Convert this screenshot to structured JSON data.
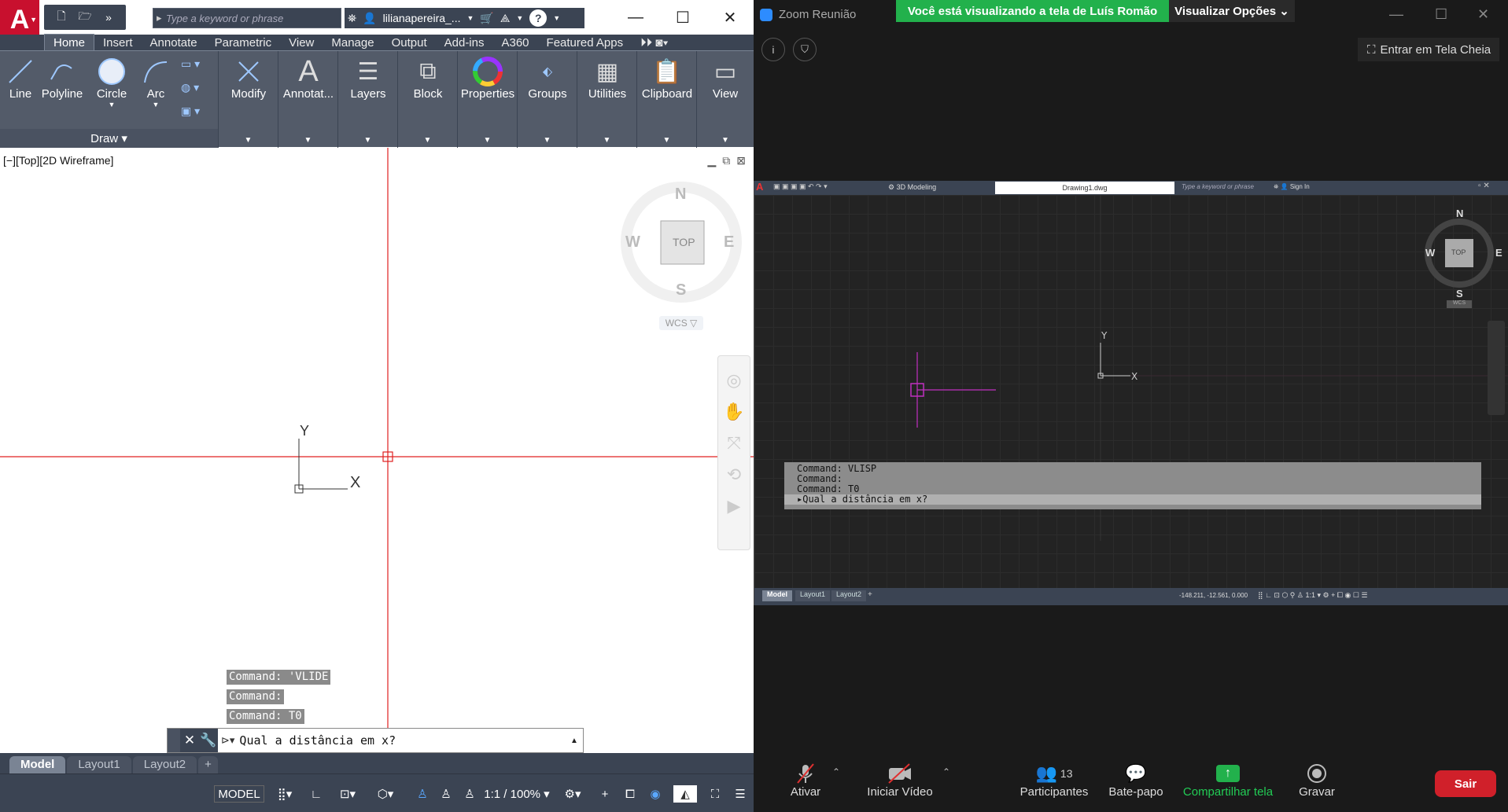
{
  "autocad": {
    "logo_letter": "A",
    "search_placeholder": "Type a keyword or phrase",
    "user_name": "lilianapereira_...",
    "help_label": "?",
    "ribbon_tabs": [
      "Home",
      "Insert",
      "Annotate",
      "Parametric",
      "View",
      "Manage",
      "Output",
      "Add-ins",
      "A360",
      "Featured Apps"
    ],
    "draw_tools": [
      "Line",
      "Polyline",
      "Circle",
      "Arc"
    ],
    "draw_panel_label": "Draw",
    "panels": [
      "Modify",
      "Annotat...",
      "Layers",
      "Block",
      "Properties",
      "Groups",
      "Utilities",
      "Clipboard",
      "View"
    ],
    "viewport_label": "[−][Top][2D Wireframe]",
    "viewcube": {
      "north": "N",
      "south": "S",
      "east": "E",
      "west": "W",
      "face": "TOP",
      "wcs": "WCS"
    },
    "ucs": {
      "x": "X",
      "y": "Y"
    },
    "command_history": [
      "Command: 'VLIDE",
      "Command:",
      "Command: T0"
    ],
    "command_prompt": "Qual a distância em x?",
    "layout_tabs": [
      "Model",
      "Layout1",
      "Layout2"
    ],
    "status": {
      "model": "MODEL",
      "scale": "1:1 / 100%"
    }
  },
  "zoom": {
    "app_title": "Zoom Reunião",
    "banner": "Você está visualizando a tela de Luís Romão",
    "view_options": "Visualizar Opções",
    "fullscreen": "Entrar em Tela Cheia",
    "shared_screen": {
      "workspace": "3D Modeling",
      "file_name": "Drawing1.dwg",
      "search_placeholder": "Type a keyword or phrase",
      "sign_in": "Sign In",
      "command_history": [
        "Command: VLISP",
        "Command:",
        "Command: T0"
      ],
      "command_prompt": "Qual a distância em x?",
      "layout_tabs": [
        "Model",
        "Layout1",
        "Layout2"
      ],
      "coords": "-148.211, -12.561, 0.000",
      "scale": "1:1",
      "viewcube": {
        "north": "N",
        "south": "S",
        "east": "E",
        "west": "W",
        "face": "TOP",
        "wcs": "WCS"
      }
    },
    "toolbar": {
      "mute": "Ativar",
      "video": "Iniciar Vídeo",
      "participants": "Participantes",
      "participants_count": "13",
      "chat": "Bate-papo",
      "share": "Compartilhar tela",
      "record": "Gravar",
      "leave": "Sair"
    }
  },
  "colors": {
    "crosshair": "#e02020",
    "share_green": "#22b14c",
    "leave_red": "#d0202a",
    "acad_dark": "#3b4453"
  }
}
